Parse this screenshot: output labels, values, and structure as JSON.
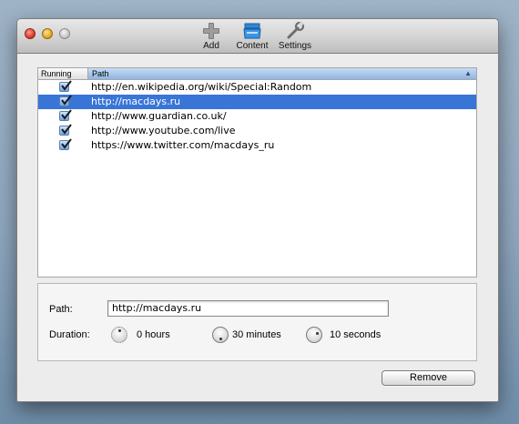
{
  "toolbar": {
    "buttons": [
      {
        "label": "Add",
        "icon": "add-icon"
      },
      {
        "label": "Content",
        "icon": "content-icon"
      },
      {
        "label": "Settings",
        "icon": "settings-icon"
      }
    ]
  },
  "table": {
    "columns": [
      "Running",
      "Path"
    ],
    "sort_indicator": "▲",
    "rows": [
      {
        "running": true,
        "path": "http://en.wikipedia.org/wiki/Special:Random",
        "selected": false
      },
      {
        "running": true,
        "path": "http://macdays.ru",
        "selected": true
      },
      {
        "running": true,
        "path": "http://www.guardian.co.uk/",
        "selected": false
      },
      {
        "running": true,
        "path": "http://www.youtube.com/live",
        "selected": false
      },
      {
        "running": true,
        "path": "https://www.twitter.com/macdays_ru",
        "selected": false
      }
    ]
  },
  "detail": {
    "path_label": "Path:",
    "path_value": "http://macdays.ru",
    "duration_label": "Duration:",
    "hours": "0 hours",
    "minutes": "30 minutes",
    "seconds": "10 seconds"
  },
  "remove_label": "Remove",
  "colors": {
    "selection": "#3875d7",
    "header_selected": "#8fb5e2",
    "checkbox": "#6ea4e2"
  }
}
